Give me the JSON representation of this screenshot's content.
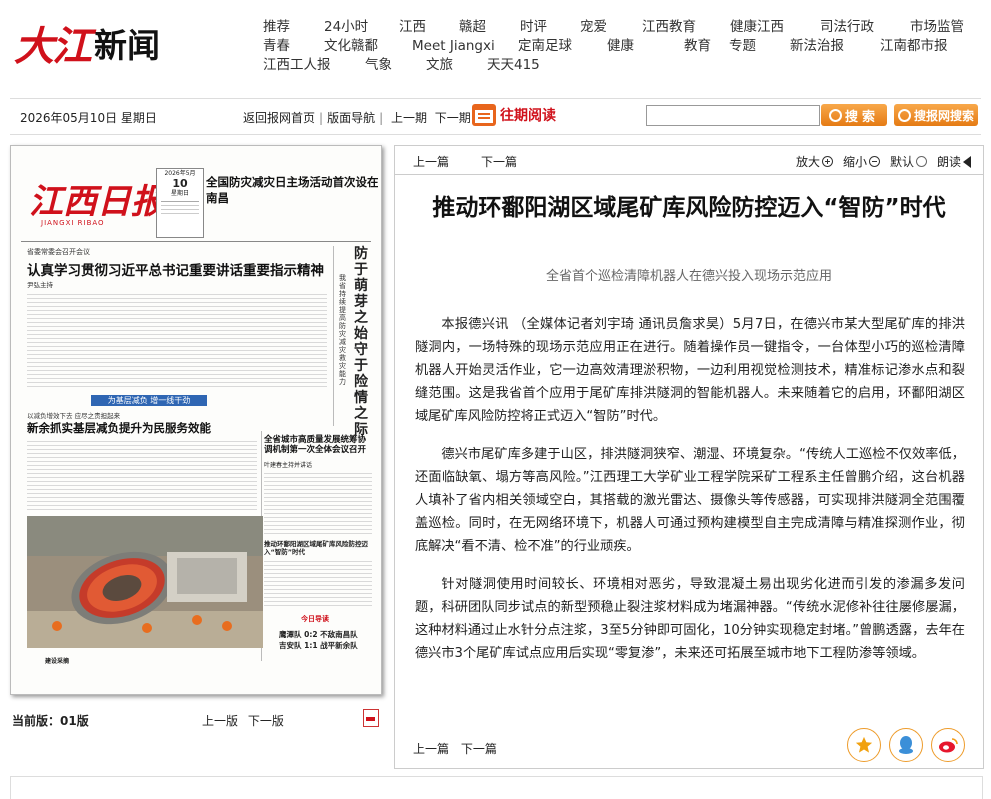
{
  "header": {
    "logo_red": "大江",
    "logo_black": "新闻",
    "nav_rows": [
      [
        "推荐",
        "24小时",
        "江西",
        "赣超",
        "时评",
        "宠爱",
        "江西教育",
        "健康江西",
        "司法行政",
        "市场监管"
      ],
      [
        "青春",
        "文化赣鄱",
        "Meet Jiangxi",
        "定南足球",
        "健康",
        "教育",
        "专题",
        "新法治报",
        "江南都市报"
      ],
      [
        "江西工人报",
        "气象",
        "文旅",
        "天天415"
      ]
    ]
  },
  "toolbar": {
    "date": "2026年05月10日 星期日",
    "home_link": "返回报网首页",
    "nav_link": "版面导航",
    "prev_issue": "上一期",
    "next_issue": "下一期",
    "past_label": "往期阅读",
    "search_value": "",
    "search_btn": "搜索",
    "site_search_btn": "搜报网搜索"
  },
  "newspaper": {
    "logo": "江西日报",
    "logo_sub": "JIANGXI RIBAO",
    "date_month": "2026年5月",
    "date_day": "10",
    "date_week": "星期日",
    "headline1": "全国防灾减灾日主场活动首次设在南昌",
    "kicker2": "省委常委会召开会议",
    "headline2": "认真学习贯彻习近平总书记重要讲话重要指示精神",
    "byline2": "尹弘主持",
    "vertical_head": "防于萌芽之始 守于险情之际",
    "vertical_sub": "我省持续提高防灾减灾救灾能力",
    "blue_banner": "为基层减负 增一线干劲",
    "kicker3": "以减负增效下去 应尽之责担起来",
    "headline3": "新余抓实基层减负提升为民服务效能",
    "headline4": "全省城市高质量发展统筹协调机制第一次全体会议召开",
    "byline4": "叶建春主持并讲话",
    "headline5": "推动环鄱阳湖区域尾矿库风险防控迈入“智防”时代",
    "guide_title": "今日导读",
    "guide1": "鹰潭队 0:2 不敌南昌队",
    "guide2": "吉安队 1:1 战平新余队",
    "bottom": "建设采摘"
  },
  "page_footer": {
    "current": "当前版：",
    "current_value": "01版",
    "prev": "上一版",
    "next": "下一版"
  },
  "article": {
    "prev": "上一篇",
    "next": "下一篇",
    "zoom_in": "放大",
    "zoom_out": "缩小",
    "default": "默认",
    "read": "朗读",
    "title": "推动环鄱阳湖区域尾矿库风险防控迈入“智防”时代",
    "subtitle": "全省首个巡检清障机器人在德兴投入现场示范应用",
    "paragraphs": [
      "本报德兴讯 （全媒体记者刘宇琦 通讯员詹求昊）5月7日，在德兴市某大型尾矿库的排洪隧洞内，一场特殊的现场示范应用正在进行。随着操作员一键指令，一台体型小巧的巡检清障机器人开始灵活作业，它一边高效清理淤积物，一边利用视觉检测技术，精准标记渗水点和裂缝范围。这是我省首个应用于尾矿库排洪隧洞的智能机器人。未来随着它的启用，环鄱阳湖区域尾矿库风险防控将正式迈入“智防”时代。",
      "德兴市尾矿库多建于山区，排洪隧洞狭窄、潮湿、环境复杂。“传统人工巡检不仅效率低，还面临缺氧、塌方等高风险。”江西理工大学矿业工程学院采矿工程系主任曾鹏介绍，这台机器人填补了省内相关领域空白，其搭载的激光雷达、摄像头等传感器，可实现排洪隧洞全范围覆盖巡检。同时，在无网络环境下，机器人可通过预构建模型自主完成清障与精准探测作业，彻底解决“看不清、检不准”的行业顽疾。",
      "针对隧洞使用时间较长、环境相对恶劣，导致混凝土易出现劣化进而引发的渗漏多发问题，科研团队同步试点的新型预稳止裂注浆材料成为堵漏神器。“传统水泥修补往往屡修屡漏，这种材料通过止水针分点注浆，3至5分钟即可固化，10分钟实现稳定封堵。”曾鹏透露，去年在德兴市3个尾矿库试点应用后实现“零复渗”，未来还可拓展至城市地下工程防渗等领域。"
    ],
    "bottom_prev": "上一篇",
    "bottom_next": "下一篇"
  },
  "share_icons": [
    "star-icon",
    "qq-icon",
    "weibo-icon"
  ]
}
